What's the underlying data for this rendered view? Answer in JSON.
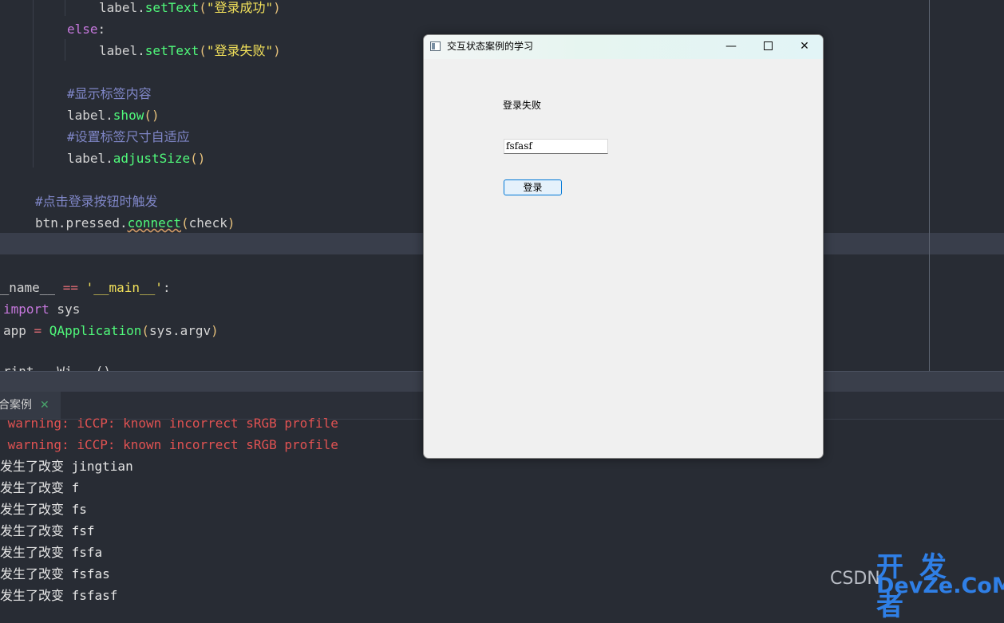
{
  "editor": {
    "lines": [
      {
        "t1": "label.",
        "f": "setText",
        "p1": "(",
        "s": "\"登录成功\"",
        "p2": ")"
      },
      {
        "kw": "else",
        "rest": ":"
      },
      {
        "t1": "label.",
        "f": "setText",
        "p1": "(",
        "s": "\"登录失败\"",
        "p2": ")"
      },
      {
        "comment": "#显示标签内容"
      },
      {
        "t1": "label.",
        "f": "show",
        "p": "()"
      },
      {
        "comment": "#设置标签尺寸自适应"
      },
      {
        "t1": "label.",
        "f": "adjustSize",
        "p": "()"
      },
      {
        "comment": "#点击登录按钮时触发"
      },
      {
        "t1": "btn.pressed.",
        "f": "connect",
        "p1": "(",
        "arg": "check",
        "p2": ")"
      },
      {
        "a": "__name__ ",
        "op": "==",
        "s": " '__main__'",
        "b": ":"
      },
      {
        "kw": "import",
        "rest": " sys"
      },
      {
        "a": "app ",
        "op": "=",
        "f": " QApplication",
        "p1": "(",
        "arg": "sys.argv",
        "p2": ")"
      },
      {
        "partial": "rint   Wi   ()"
      }
    ]
  },
  "run_tab": {
    "label": "合案例",
    "close": "✕"
  },
  "console": {
    "lines": [
      {
        "text": " warning: iCCP: known incorrect sRGB profile",
        "type": "warn"
      },
      {
        "text": " warning: iCCP: known incorrect sRGB profile",
        "type": "warn"
      },
      {
        "text": "发生了改变 jingtian",
        "type": "normal"
      },
      {
        "text": "发生了改变 f",
        "type": "normal"
      },
      {
        "text": "发生了改变 fs",
        "type": "normal"
      },
      {
        "text": "发生了改变 fsf",
        "type": "normal"
      },
      {
        "text": "发生了改变 fsfa",
        "type": "normal"
      },
      {
        "text": "发生了改变 fsfas",
        "type": "normal"
      },
      {
        "text": "发生了改变 fsfasf",
        "type": "normal"
      }
    ]
  },
  "qt_window": {
    "title": "交互状态案例的学习",
    "minimize": "—",
    "close": "✕",
    "label_text": "登录失败",
    "input_value": "fsfasf",
    "button_label": "登录"
  },
  "watermark": {
    "csdn": "CSDN",
    "logo_top": "开发者",
    "logo_bottom": "DevZe.CoM"
  }
}
